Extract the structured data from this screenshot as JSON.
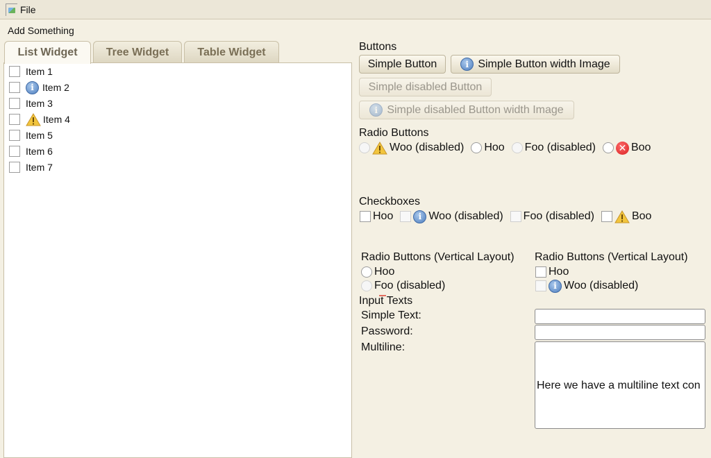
{
  "menubar": {
    "file_label": "File",
    "file_icon": "broken-image-icon"
  },
  "panel_title": "Add Something",
  "tabs": [
    {
      "label": "List Widget",
      "active": true
    },
    {
      "label": "Tree Widget",
      "active": false
    },
    {
      "label": "Table Widget",
      "active": false
    }
  ],
  "list_items": [
    {
      "label": "Item 1",
      "icon": ""
    },
    {
      "label": "Item 2",
      "icon": "info-icon"
    },
    {
      "label": "Item 3",
      "icon": ""
    },
    {
      "label": "Item 4",
      "icon": "warning-icon"
    },
    {
      "label": "Item 5",
      "icon": ""
    },
    {
      "label": "Item 6",
      "icon": ""
    },
    {
      "label": "Item 7",
      "icon": ""
    }
  ],
  "buttons": {
    "title": "Buttons",
    "simple": "Simple Button",
    "with_image": "Simple Button width Image",
    "disabled": "Simple disabled Button",
    "disabled_with_image": "Simple disabled Button width Image"
  },
  "radio_buttons": {
    "title": "Radio Buttons",
    "items": [
      {
        "label": "Woo (disabled)",
        "icon": "warning-icon",
        "disabled": true
      },
      {
        "label": "Hoo",
        "icon": "",
        "disabled": false
      },
      {
        "label": "Foo (disabled)",
        "icon": "",
        "disabled": true
      },
      {
        "label": "Boo",
        "icon": "error-icon",
        "disabled": false
      }
    ]
  },
  "checkboxes": {
    "title": "Checkboxes",
    "items": [
      {
        "label": "Hoo",
        "icon": "",
        "disabled": false
      },
      {
        "label": "Woo (disabled)",
        "icon": "info-icon",
        "disabled": true
      },
      {
        "label": "Foo (disabled)",
        "icon": "",
        "disabled": true
      },
      {
        "label": "Boo",
        "icon": "warning-icon",
        "disabled": false
      }
    ]
  },
  "vertical_radio": {
    "title": "Radio Buttons (Vertical Layout)",
    "items": [
      {
        "label": "Hoo",
        "disabled": false
      },
      {
        "label": "Foo (disabled)",
        "disabled": true
      }
    ]
  },
  "vertical_check": {
    "title": "Radio Buttons (Vertical Layout)",
    "items": [
      {
        "label": "Hoo",
        "disabled": false
      },
      {
        "label": "Woo (disabled)",
        "icon": "info-icon",
        "disabled": true
      }
    ]
  },
  "input_texts": {
    "title": "Input Texts",
    "simple_label": "Simple Text:",
    "password_label": "Password:",
    "multiline_label": "Multiline:",
    "multiline_value": "Here we have a multiline text con"
  },
  "colors": {
    "background": "#f4f0e3",
    "tab_text": "#7a6f56",
    "info": "#4f7fbf",
    "warning": "#f2c53d",
    "error": "#d81f1f"
  }
}
